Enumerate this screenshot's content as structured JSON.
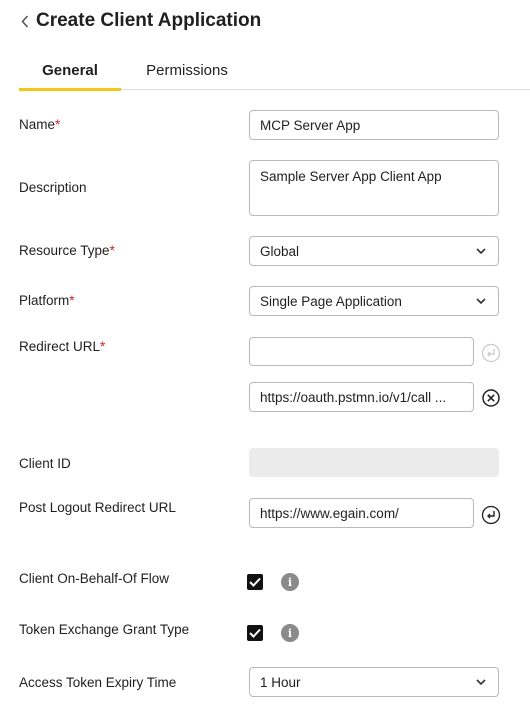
{
  "header": {
    "title": "Create Client Application",
    "back_icon": "chevron-left-icon"
  },
  "tabs": [
    {
      "label": "General",
      "active": true
    },
    {
      "label": "Permissions",
      "active": false
    }
  ],
  "accent_color": "#f5c518",
  "required_marker": "*",
  "form": {
    "name": {
      "label": "Name",
      "value": "MCP Server App",
      "required": true
    },
    "description": {
      "label": "Description",
      "value": "Sample Server App Client App"
    },
    "resource_type": {
      "label": "Resource Type",
      "value": "Global",
      "required": true
    },
    "platform": {
      "label": "Platform",
      "value": "Single Page Application",
      "required": true
    },
    "redirect_url": {
      "label": "Redirect URL",
      "required": true,
      "new_value": "",
      "entries": [
        "https://oauth.pstmn.io/v1/call ..."
      ]
    },
    "client_id": {
      "label": "Client ID",
      "value": ""
    },
    "post_logout_redirect_url": {
      "label": "Post Logout Redirect URL",
      "value": "https://www.egain.com/"
    },
    "client_obo_flow": {
      "label": "Client On-Behalf-Of Flow",
      "checked": true,
      "info": "i"
    },
    "token_exchange": {
      "label": "Token Exchange Grant Type",
      "checked": true,
      "info": "i"
    },
    "access_token_expiry": {
      "label": "Access Token Expiry Time",
      "value": "1 Hour"
    }
  }
}
